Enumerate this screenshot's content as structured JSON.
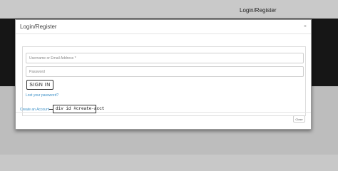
{
  "header": {
    "login_register_link": "Login/Register"
  },
  "modal": {
    "title": "Login/Register",
    "close_icon": "×",
    "form": {
      "username_placeholder": "Username or Email Address *",
      "password_placeholder": "Password",
      "signin_label": "SIGN IN",
      "lost_password_link": "Lost your password?"
    },
    "create_account_link": "Create an Account",
    "dev_annotation": "div id #create-acct",
    "close_button_label": "Close"
  }
}
